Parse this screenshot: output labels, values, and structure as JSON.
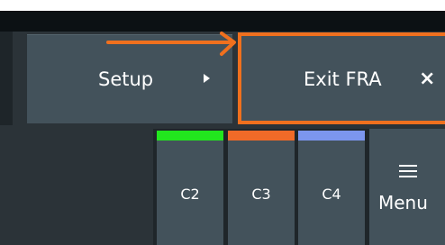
{
  "toolbar": {
    "setup_label": "Setup",
    "exit_label": "Exit FRA",
    "exit_icon": "×"
  },
  "channels": [
    {
      "label": "C2",
      "color": "#22e61e"
    },
    {
      "label": "C3",
      "color": "#f06a28"
    },
    {
      "label": "C4",
      "color": "#7c96ee"
    }
  ],
  "menu": {
    "label": "Menu"
  },
  "colors": {
    "highlight": "#f0701e",
    "panel": "#2b3338",
    "button": "#43525b"
  }
}
